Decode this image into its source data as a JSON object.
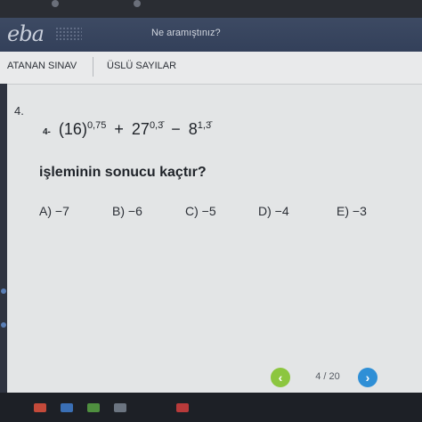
{
  "header": {
    "search_placeholder": "Ne aramıştınız?"
  },
  "tabs": [
    {
      "label": "ATANAN SINAV"
    },
    {
      "label": "ÜSLÜ SAYILAR"
    }
  ],
  "question": {
    "number": "4.",
    "expression": {
      "prefix": "4-",
      "term1_base": "(16)",
      "term1_exp": "0,75",
      "op1": "+",
      "term2_base": "27",
      "term2_exp": "0,3̄",
      "op2": "−",
      "term3_base": "8",
      "term3_exp": "1,3̄"
    },
    "prompt": "işleminin sonucu kaçtır?",
    "choices": [
      {
        "label": "A) −7"
      },
      {
        "label": "B) −6"
      },
      {
        "label": "C) −5"
      },
      {
        "label": "D) −4"
      },
      {
        "label": "E) −3"
      }
    ]
  },
  "pagination": {
    "prev_icon": "chevron-left-icon",
    "next_icon": "chevron-right-icon",
    "counter": "4 / 20"
  },
  "colors": {
    "header_bg": "#3a4660",
    "prev_button": "#8cc63f",
    "next_button": "#2f8fd6"
  }
}
